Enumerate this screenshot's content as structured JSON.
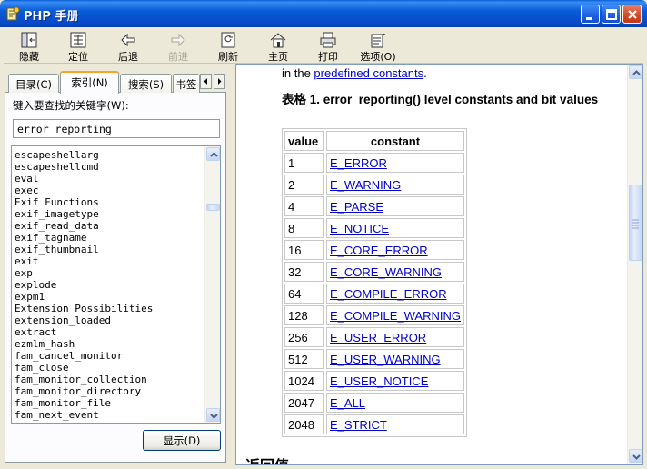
{
  "window": {
    "title": "PHP 手册",
    "colors": {
      "titlebar": "#0a5bd6",
      "close_button": "#d34a26",
      "link": "#0000cc"
    }
  },
  "toolbar": {
    "buttons": [
      {
        "icon": "hide-icon",
        "label": "隐藏"
      },
      {
        "icon": "locate-icon",
        "label": "定位"
      },
      {
        "icon": "back-arrow-icon",
        "label": "后退"
      },
      {
        "icon": "forward-arrow-icon",
        "label": "前进",
        "disabled": true
      },
      {
        "icon": "refresh-icon",
        "label": "刷新"
      },
      {
        "icon": "home-icon",
        "label": "主页"
      },
      {
        "icon": "print-icon",
        "label": "打印"
      },
      {
        "icon": "options-icon",
        "label": "选项(O)"
      }
    ]
  },
  "tabs": [
    {
      "label": "目录(C)"
    },
    {
      "label": "索引(N)",
      "active": true
    },
    {
      "label": "搜索(S)"
    },
    {
      "label": "书签"
    }
  ],
  "index_panel": {
    "prompt": "键入要查找的关键字(W):",
    "keyword_value": "error_reporting",
    "keywords": [
      "escapeshellarg",
      "escapeshellcmd",
      "eval",
      "exec",
      "Exif Functions",
      "exif_imagetype",
      "exif_read_data",
      "exif_tagname",
      "exif_thumbnail",
      "exit",
      "exp",
      "explode",
      "expm1",
      "Extension Possibilities",
      "extension_loaded",
      "extract",
      "ezmlm_hash",
      "fam_cancel_monitor",
      "fam_close",
      "fam_monitor_collection",
      "fam_monitor_directory",
      "fam_monitor_file",
      "fam_next_event"
    ],
    "display_button": "显示(D)"
  },
  "content": {
    "intro_prefix": "in the ",
    "intro_link": "predefined constants",
    "intro_suffix": ".",
    "caption_prefix": "表格",
    "caption_text": " 1. error_reporting() level constants and bit values",
    "table": {
      "headers": [
        "value",
        "constant"
      ],
      "rows": [
        {
          "value": "1",
          "constant": "E_ERROR"
        },
        {
          "value": "2",
          "constant": "E_WARNING"
        },
        {
          "value": "4",
          "constant": "E_PARSE"
        },
        {
          "value": "8",
          "constant": "E_NOTICE"
        },
        {
          "value": "16",
          "constant": "E_CORE_ERROR"
        },
        {
          "value": "32",
          "constant": "E_CORE_WARNING"
        },
        {
          "value": "64",
          "constant": "E_COMPILE_ERROR"
        },
        {
          "value": "128",
          "constant": "E_COMPILE_WARNING"
        },
        {
          "value": "256",
          "constant": "E_USER_ERROR"
        },
        {
          "value": "512",
          "constant": "E_USER_WARNING"
        },
        {
          "value": "1024",
          "constant": "E_USER_NOTICE"
        },
        {
          "value": "2047",
          "constant": "E_ALL"
        },
        {
          "value": "2048",
          "constant": "E_STRICT"
        }
      ]
    },
    "next_section_heading": "返回值"
  }
}
